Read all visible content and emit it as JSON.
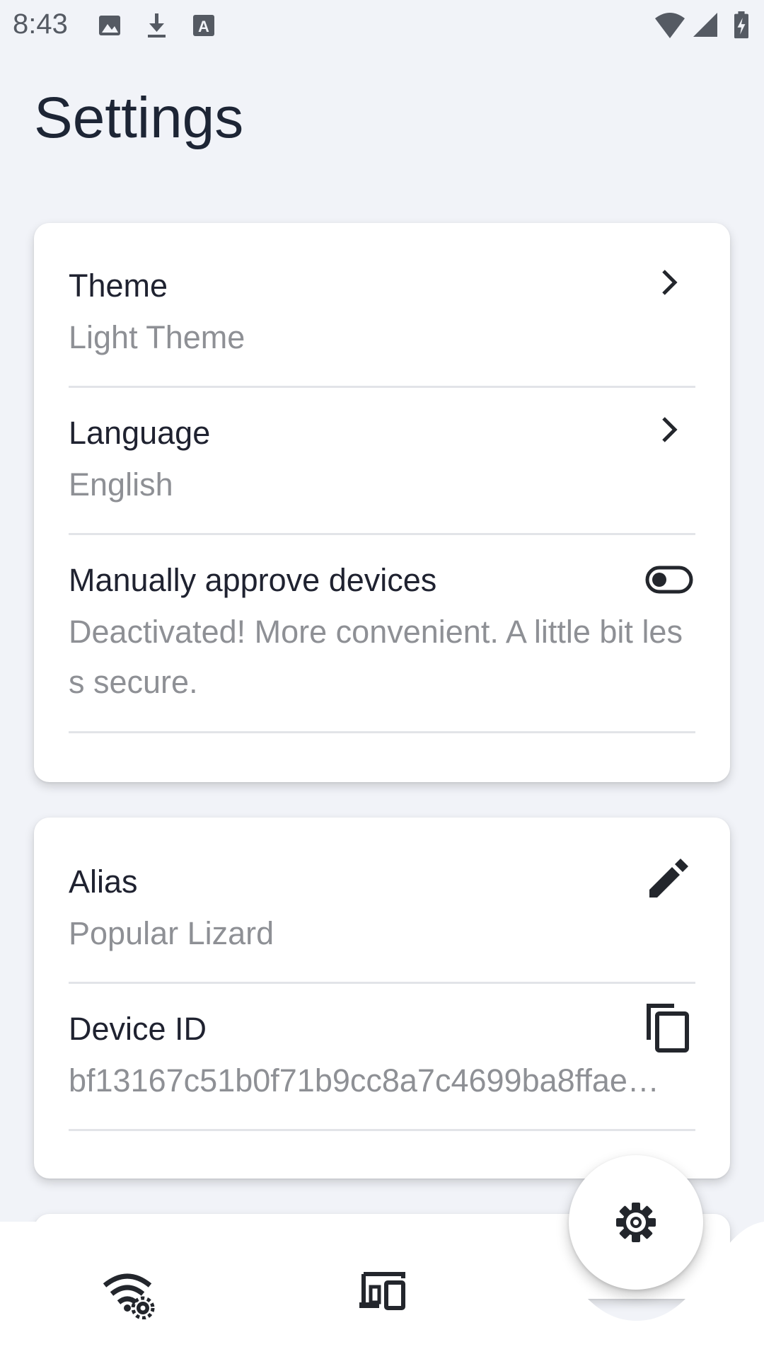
{
  "status_bar": {
    "time": "8:43",
    "left_icons": [
      "image-icon",
      "download-icon",
      "keyboard-a-icon"
    ],
    "right_icons": [
      "wifi-icon",
      "cellular-signal-icon",
      "battery-charging-icon"
    ]
  },
  "page": {
    "title": "Settings"
  },
  "card_preferences": {
    "theme": {
      "title": "Theme",
      "value": "Light Theme",
      "action_icon": "chevron-right-icon"
    },
    "language": {
      "title": "Language",
      "value": "English",
      "action_icon": "chevron-right-icon"
    },
    "approve_devices": {
      "title": "Manually approve devices",
      "description": "Deactivated! More convenient. A little bit less secure.",
      "toggle_state": "off",
      "action_icon": "toggle-off-icon"
    }
  },
  "card_device": {
    "alias": {
      "title": "Alias",
      "value": "Popular Lizard",
      "action_icon": "edit-pencil-icon"
    },
    "device_id": {
      "title": "Device ID",
      "value": "bf13167c51b0f71b9cc8a7c4699ba8ffae…",
      "action_icon": "copy-icon"
    }
  },
  "bottom_nav": {
    "items": [
      {
        "icon": "wifi-settings-icon"
      },
      {
        "icon": "devices-icon"
      },
      {
        "icon": "gear-icon",
        "selected": true
      }
    ]
  },
  "colors": {
    "background": "#f1f3f8",
    "card": "#ffffff",
    "title_text": "#1d2535",
    "primary_text": "#1f2230",
    "secondary_text": "#8e9095",
    "divider": "#e2e4e8",
    "icon": "#23262c"
  }
}
